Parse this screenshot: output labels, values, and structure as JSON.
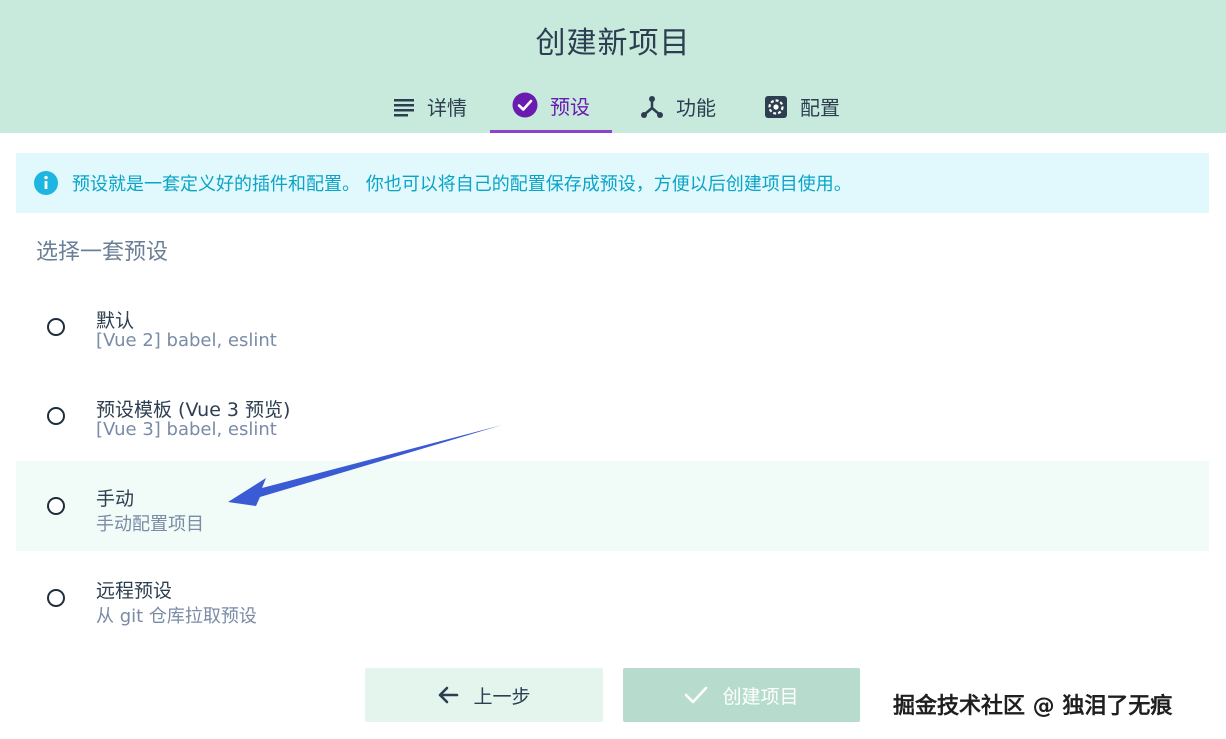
{
  "header": {
    "title": "创建新项目",
    "tabs": [
      {
        "label": "详情",
        "icon": "list-icon"
      },
      {
        "label": "预设",
        "icon": "check-circle-icon",
        "active": true
      },
      {
        "label": "功能",
        "icon": "fork-icon"
      },
      {
        "label": "配置",
        "icon": "gear-icon"
      }
    ]
  },
  "info": {
    "text": "预设就是一套定义好的插件和配置。 你也可以将自己的配置保存成预设，方便以后创建项目使用。",
    "icon": "info-icon"
  },
  "presets": {
    "section_title": "选择一套预设",
    "options": [
      {
        "title": "默认",
        "desc": "[Vue 2] babel, eslint"
      },
      {
        "title": "预设模板 (Vue 3 预览)",
        "desc": "[Vue 3] babel, eslint"
      },
      {
        "title": "手动",
        "desc": "手动配置项目"
      },
      {
        "title": "远程预设",
        "desc": "从 git 仓库拉取预设"
      }
    ]
  },
  "footer": {
    "prev_label": "上一步",
    "create_label": "创建项目"
  },
  "watermark": "掘金技术社区 @ 独泪了无痕",
  "colors": {
    "header_bg": "#c8eadd",
    "active_tab": "#6a1bb0",
    "info_bg": "#e1f8fc",
    "info_text": "#0aa4c7",
    "annotation_arrow": "#3a5bd4"
  }
}
